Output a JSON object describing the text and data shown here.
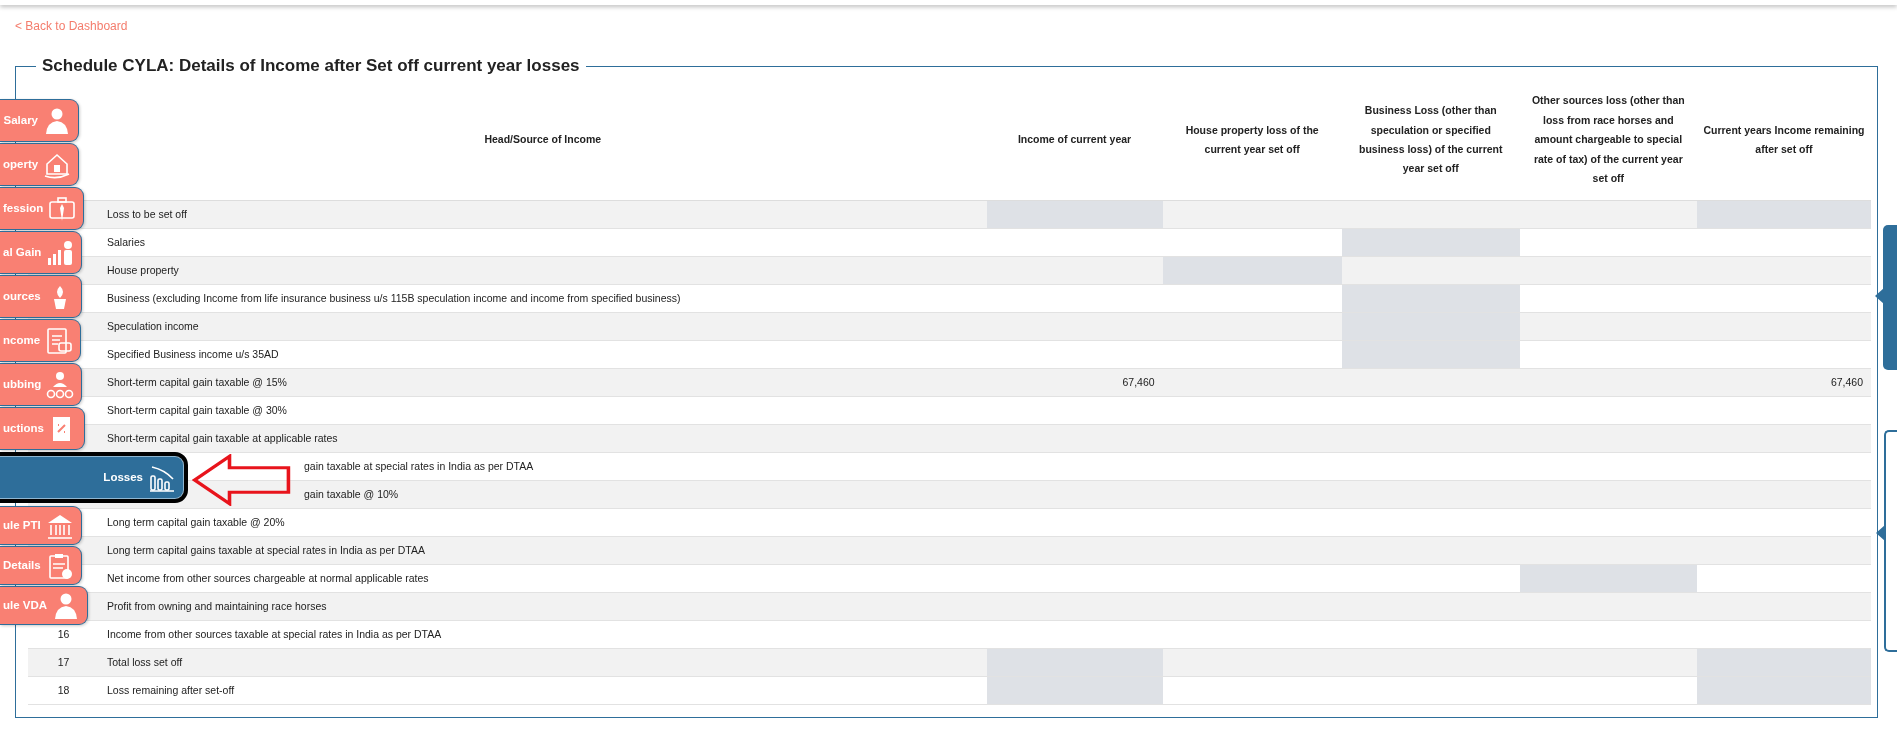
{
  "back_link": "< Back to Dashboard",
  "title": "Schedule CYLA: Details of Income after Set off current year losses",
  "sidebar": [
    {
      "label": "Salary",
      "selected": false
    },
    {
      "label": "operty",
      "selected": false
    },
    {
      "label": "fession",
      "selected": false
    },
    {
      "label": "al Gain",
      "selected": false
    },
    {
      "label": "ources",
      "selected": false
    },
    {
      "label": "ncome",
      "selected": false
    },
    {
      "label": "ubbing",
      "selected": false
    },
    {
      "label": "uctions",
      "selected": false
    },
    {
      "label": "Losses",
      "selected": true
    },
    {
      "label": "ule PTI",
      "selected": false
    },
    {
      "label": "Details",
      "selected": false
    },
    {
      "label": "ule VDA",
      "selected": false
    }
  ],
  "table": {
    "columns": [
      "Head/Source of Income",
      "Income of current year",
      "House property loss of the current year set off",
      "Business Loss (other than speculation or specified business loss) of the current year set off",
      "Other sources loss (other than loss from race horses and amount chargeable to special rate of tax) of the current year set off",
      "Current years Income remaining after set off"
    ],
    "rows": [
      {
        "kind": "plain",
        "cells": [
          {
            "value": "Loss to be set off",
            "disabled": false
          },
          {
            "disabled": true
          },
          {
            "disabled": false
          },
          {
            "disabled": false
          },
          {
            "disabled": false
          },
          {
            "disabled": true
          }
        ]
      },
      {
        "kind": "plain",
        "cells": [
          {
            "value": "Salaries",
            "disabled": false
          },
          {
            "disabled": false
          },
          {
            "disabled": false
          },
          {
            "disabled": true
          },
          {
            "disabled": false
          },
          {
            "disabled": false
          }
        ]
      },
      {
        "kind": "plain",
        "cells": [
          {
            "value": "House property",
            "disabled": false
          },
          {
            "disabled": false
          },
          {
            "disabled": true
          },
          {
            "disabled": false
          },
          {
            "disabled": false
          },
          {
            "disabled": false
          }
        ]
      },
      {
        "kind": "plain",
        "cells": [
          {
            "value": "Business (excluding Income from life insurance business u/s 115B speculation income and income from specified business)",
            "disabled": false
          },
          {
            "disabled": false
          },
          {
            "disabled": false
          },
          {
            "disabled": true
          },
          {
            "disabled": false
          },
          {
            "disabled": false
          }
        ]
      },
      {
        "kind": "plain",
        "cells": [
          {
            "value": "Speculation income",
            "disabled": false
          },
          {
            "disabled": false
          },
          {
            "disabled": false
          },
          {
            "disabled": true
          },
          {
            "disabled": false
          },
          {
            "disabled": false
          }
        ]
      },
      {
        "kind": "plain",
        "cells": [
          {
            "value": "Specified Business income u/s 35AD",
            "disabled": false
          },
          {
            "disabled": false
          },
          {
            "disabled": false
          },
          {
            "disabled": true
          },
          {
            "disabled": false
          },
          {
            "disabled": false
          }
        ]
      },
      {
        "kind": "plain",
        "cells": [
          {
            "value": "Short-term capital gain taxable @ 15%",
            "disabled": false
          },
          {
            "disabled": false,
            "value": "67,460"
          },
          {
            "disabled": false
          },
          {
            "disabled": false
          },
          {
            "disabled": false
          },
          {
            "disabled": false,
            "value": "67,460"
          }
        ]
      },
      {
        "kind": "plain",
        "cells": [
          {
            "value": "Short-term capital gain taxable @ 30%",
            "disabled": false
          },
          {
            "disabled": false
          },
          {
            "disabled": false
          },
          {
            "disabled": false
          },
          {
            "disabled": false
          },
          {
            "disabled": false
          }
        ]
      },
      {
        "kind": "plain",
        "cells": [
          {
            "value": "Short-term capital gain taxable at applicable rates",
            "disabled": false
          },
          {
            "disabled": false
          },
          {
            "disabled": false
          },
          {
            "disabled": false
          },
          {
            "disabled": false
          },
          {
            "disabled": false
          }
        ]
      },
      {
        "kind": "covered",
        "cells": [
          {
            "value": "gain taxable at special rates in India as per DTAA",
            "disabled": false
          },
          {
            "disabled": false
          },
          {
            "disabled": false
          },
          {
            "disabled": false
          },
          {
            "disabled": false
          },
          {
            "disabled": false
          }
        ]
      },
      {
        "kind": "covered",
        "cells": [
          {
            "value": "gain taxable @ 10%",
            "disabled": false
          },
          {
            "disabled": false
          },
          {
            "disabled": false
          },
          {
            "disabled": false
          },
          {
            "disabled": false
          },
          {
            "disabled": false
          }
        ]
      },
      {
        "kind": "plain",
        "cells": [
          {
            "value": "Long term capital gain taxable @ 20%",
            "disabled": false
          },
          {
            "disabled": false
          },
          {
            "disabled": false
          },
          {
            "disabled": false
          },
          {
            "disabled": false
          },
          {
            "disabled": false
          }
        ]
      },
      {
        "kind": "plain",
        "cells": [
          {
            "value": "Long term capital gains taxable at special rates in India as per DTAA",
            "disabled": false
          },
          {
            "disabled": false
          },
          {
            "disabled": false
          },
          {
            "disabled": false
          },
          {
            "disabled": false
          },
          {
            "disabled": false
          }
        ]
      },
      {
        "kind": "plain",
        "cells": [
          {
            "value": "Net income from other sources chargeable at normal applicable rates",
            "disabled": false
          },
          {
            "disabled": false
          },
          {
            "disabled": false
          },
          {
            "disabled": false
          },
          {
            "disabled": true
          },
          {
            "disabled": false
          }
        ]
      },
      {
        "kind": "plain",
        "cells": [
          {
            "value": "Profit from owning and maintaining race horses",
            "disabled": false
          },
          {
            "disabled": false
          },
          {
            "disabled": false
          },
          {
            "disabled": false
          },
          {
            "disabled": false
          },
          {
            "disabled": false
          }
        ]
      },
      {
        "kind": "plain",
        "no": "16",
        "cells": [
          {
            "value": "Income from other sources taxable at special rates in India as per DTAA",
            "disabled": false
          },
          {
            "disabled": false
          },
          {
            "disabled": false
          },
          {
            "disabled": false
          },
          {
            "disabled": false
          },
          {
            "disabled": false
          }
        ]
      },
      {
        "kind": "plain",
        "no": "17",
        "cells": [
          {
            "value": "Total loss set off",
            "disabled": false
          },
          {
            "disabled": true
          },
          {
            "disabled": false
          },
          {
            "disabled": false
          },
          {
            "disabled": false
          },
          {
            "disabled": true
          }
        ]
      },
      {
        "kind": "plain",
        "no": "18",
        "cells": [
          {
            "value": "Loss remaining after set-off",
            "disabled": false
          },
          {
            "disabled": true
          },
          {
            "disabled": false
          },
          {
            "disabled": false
          },
          {
            "disabled": false
          },
          {
            "disabled": true
          }
        ]
      }
    ]
  }
}
